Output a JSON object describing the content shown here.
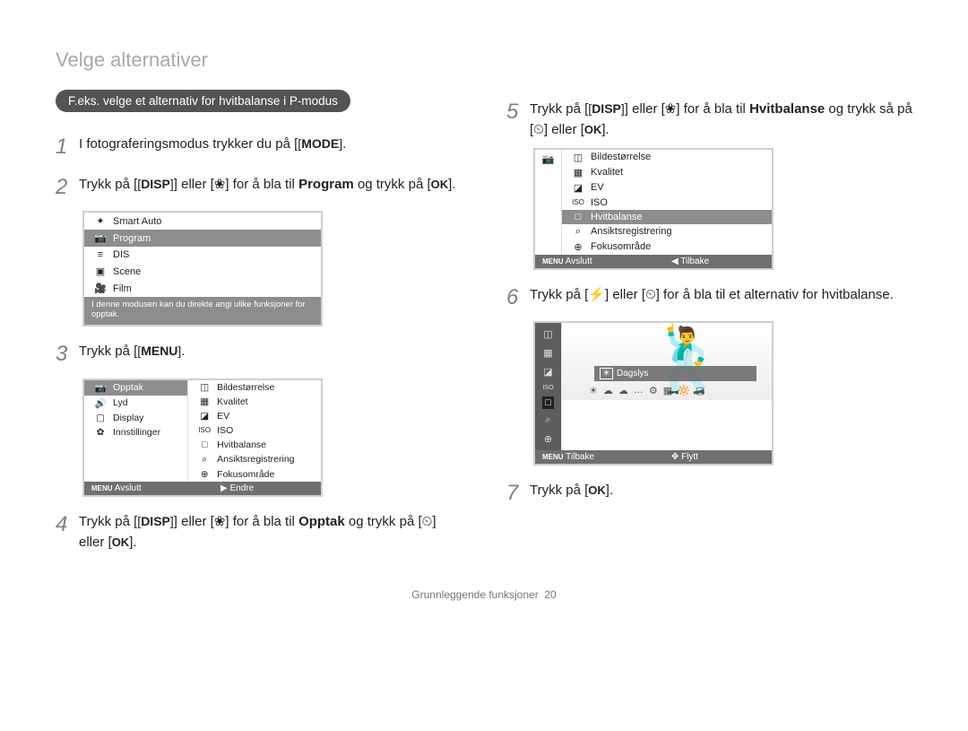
{
  "page_title": "Velge alternativer",
  "section_heading": "F.eks. velge et alternativ for hvitbalanse i P-modus",
  "buttons": {
    "mode": "MODE",
    "disp": "DISP",
    "menu_btn": "MENU",
    "ok": "OK"
  },
  "steps": {
    "s1": {
      "num": "1",
      "pre": "I fotograferingsmodus trykker du på [",
      "post": "]."
    },
    "s2": {
      "num": "2",
      "pre": "Trykk på [",
      "mid1": "] eller [",
      "flower": "❀",
      "mid2": "] for å bla til ",
      "bold": "Program",
      "post": " og trykk på [",
      "end": "]."
    },
    "s3": {
      "num": "3",
      "pre": "Trykk på [",
      "post": "]."
    },
    "s4": {
      "num": "4",
      "pre": "Trykk på [",
      "mid1": "] eller [",
      "flower": "❀",
      "mid2": "] for å bla til ",
      "bold": "Opptak",
      "post": " og trykk på [",
      "timer": "⏲",
      "mid3": "] eller [",
      "end": "]."
    },
    "s5": {
      "num": "5",
      "pre": "Trykk på [",
      "mid1": "] eller [",
      "flower": "❀",
      "mid2": "] for å bla til ",
      "bold": "Hvitbalanse",
      "post": " og trykk så på [",
      "timer": "⏲",
      "mid3": "] eller [",
      "end": "]."
    },
    "s6": {
      "num": "6",
      "pre": "Trykk på [",
      "flash": "⚡",
      "mid1": "] eller [",
      "timer": "⏲",
      "mid2": "] for å bla til et alternativ for hvitbalanse."
    },
    "s7": {
      "num": "7",
      "pre": "Trykk på [",
      "end": "]."
    }
  },
  "lcd_mode": {
    "items": [
      {
        "icon": "✦",
        "label": "Smart Auto"
      },
      {
        "icon": "📷",
        "label": "Program",
        "selected": true
      },
      {
        "icon": "≡",
        "label": "DIS"
      },
      {
        "icon": "▣",
        "label": "Scene"
      },
      {
        "icon": "🎥",
        "label": "Film"
      }
    ],
    "note": "I denne modusen kan du direkte angi ulike funksjoner for opptak."
  },
  "lcd_menu": {
    "left": [
      {
        "icon": "📷",
        "label": "Opptak",
        "selected": true
      },
      {
        "icon": "🔊",
        "label": "Lyd"
      },
      {
        "icon": "▢",
        "label": "Display"
      },
      {
        "icon": "✿",
        "label": "Innstillinger"
      }
    ],
    "right": [
      {
        "icon": "◫",
        "label": "Bildestørrelse"
      },
      {
        "icon": "▦",
        "label": "Kvalitet"
      },
      {
        "icon": "◪",
        "label": "EV"
      },
      {
        "icon": "ISO",
        "label": "ISO"
      },
      {
        "icon": "□",
        "label": "Hvitbalanse"
      },
      {
        "icon": "⌕",
        "label": "Ansiktsregistrering"
      },
      {
        "icon": "⊕",
        "label": "Fokusområde"
      }
    ],
    "footer_left_label": "Avslutt",
    "footer_left_icon": "MENU",
    "footer_right_label": "Endre",
    "footer_right_icon": "▶"
  },
  "lcd_shoot": {
    "side_icon": "📷",
    "items": [
      {
        "icon": "◫",
        "label": "Bildestørrelse"
      },
      {
        "icon": "▦",
        "label": "Kvalitet"
      },
      {
        "icon": "◪",
        "label": "EV"
      },
      {
        "icon": "ISO",
        "label": "ISO"
      },
      {
        "icon": "□",
        "label": "Hvitbalanse",
        "selected": true
      },
      {
        "icon": "⌕",
        "label": "Ansiktsregistrering"
      },
      {
        "icon": "⊕",
        "label": "Fokusområde"
      }
    ],
    "footer_left_label": "Avslutt",
    "footer_left_icon": "MENU",
    "footer_right_label": "Tilbake",
    "footer_right_icon": "◀"
  },
  "lcd_wb": {
    "side_icons": [
      "◫",
      "▦",
      "◪",
      "ISO",
      "□",
      "⌕",
      "⊕"
    ],
    "label": "Dagslys",
    "sel_icon": "☀",
    "icons_row": [
      "☀",
      "☁",
      "☁",
      "…",
      "⚙",
      "▦",
      "🔆",
      "▢"
    ],
    "footer_left_label": "Tilbake",
    "footer_left_icon": "MENU",
    "footer_right_label": "Flytt",
    "footer_right_icon": "✥"
  },
  "footer": {
    "text": "Grunnleggende funksjoner",
    "page": "20"
  }
}
